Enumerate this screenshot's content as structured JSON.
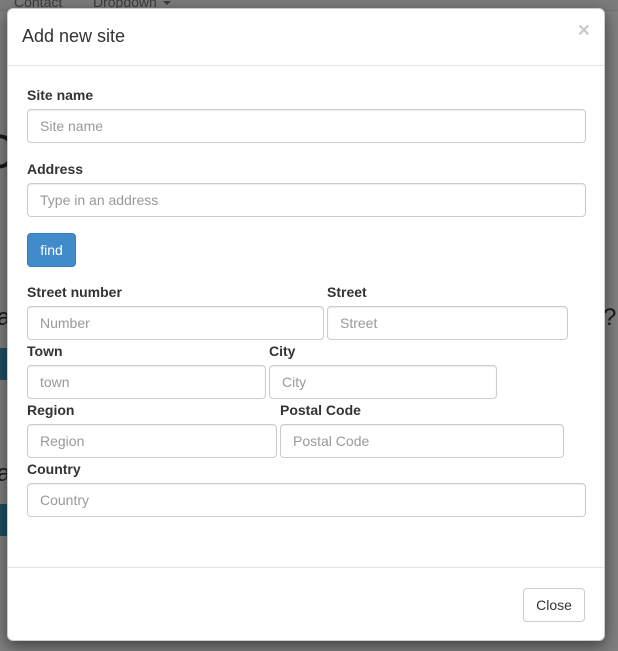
{
  "background": {
    "nav_links": [
      "Contact",
      "Dropdown"
    ],
    "big_char": "C",
    "partial_left_a": "a",
    "partial_right_q": "?",
    "partial_left_a2": "a"
  },
  "modal": {
    "title": "Add new site",
    "close_icon": "×",
    "fields": {
      "site_name": {
        "label": "Site name",
        "placeholder": "Site name"
      },
      "address": {
        "label": "Address",
        "placeholder": "Type in an address"
      },
      "street_number": {
        "label": "Street number",
        "placeholder": "Number"
      },
      "street": {
        "label": "Street",
        "placeholder": "Street"
      },
      "town": {
        "label": "Town",
        "placeholder": "town"
      },
      "city": {
        "label": "City",
        "placeholder": "City"
      },
      "region": {
        "label": "Region",
        "placeholder": "Region"
      },
      "postal_code": {
        "label": "Postal Code",
        "placeholder": "Postal Code"
      },
      "country": {
        "label": "Country",
        "placeholder": "Country"
      }
    },
    "find_button": "find",
    "footer": {
      "close_button": "Close"
    },
    "colors": {
      "primary": "#428bca",
      "backdrop": "rgba(0,0,0,0.5)"
    }
  }
}
